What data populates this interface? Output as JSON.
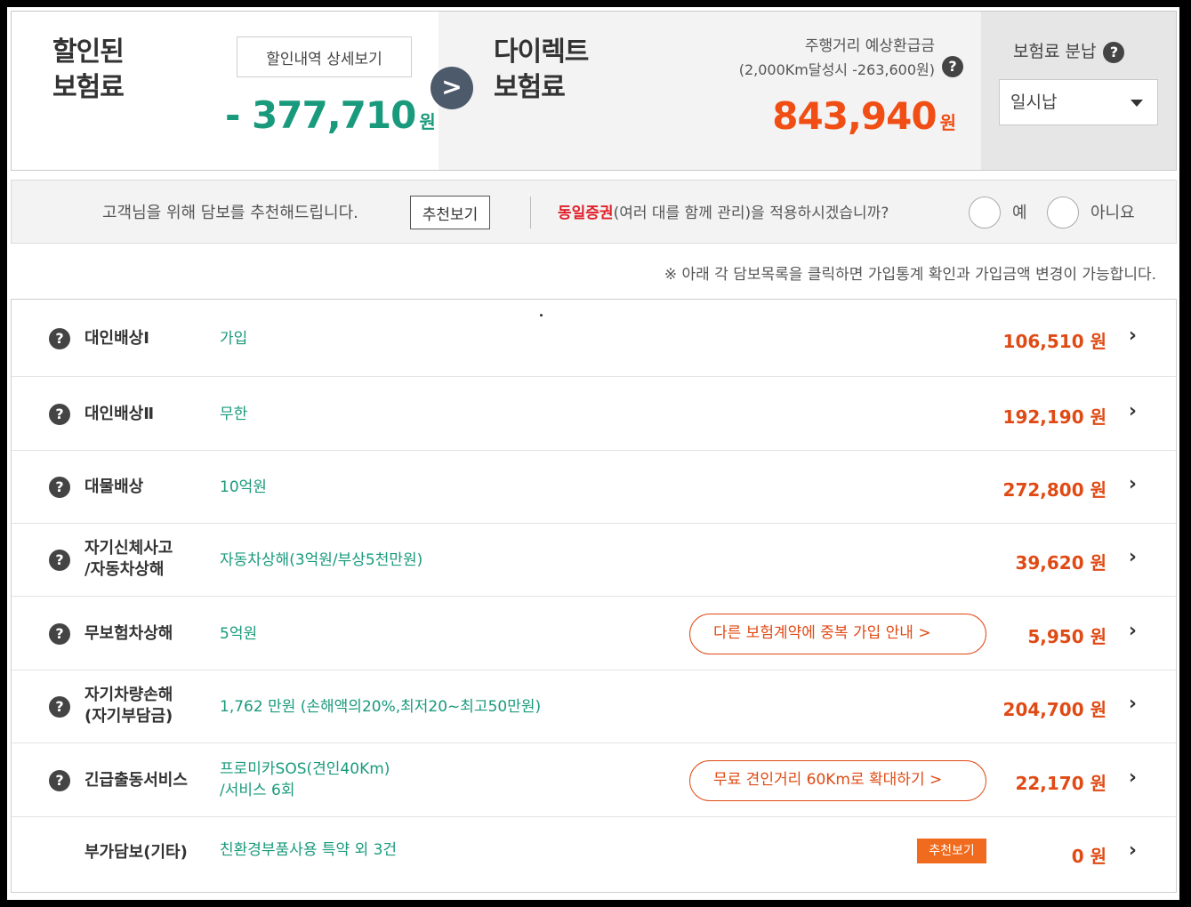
{
  "header": {
    "discounted_label_line1": "할인된",
    "discounted_label_line2": "보험료",
    "detail_button": "할인내역 상세보기",
    "discount_amount": "- 377,710",
    "won": "원",
    "arrow_symbol": ">",
    "direct_label_line1": "다이렉트",
    "direct_label_line2": "보험료",
    "mileage_line1": "주행거리 예상환급금",
    "mileage_line2": "(2,000Km달성시 -263,600원)",
    "direct_amount": "843,940",
    "installment_label": "보험료 분납",
    "installment_value": "일시납",
    "help_symbol": "?"
  },
  "recommend": {
    "text": "고객님을 위해 담보를 추천해드립니다.",
    "button": "추천보기",
    "same_cert_red": "동일증권",
    "same_cert_rest": "(여러 대를 함께 관리)을 적용하시겠습니까?",
    "yes": "예",
    "no": "아니요"
  },
  "notice": "※ 아래 각 담보목록을 클릭하면 가입통계 확인과 가입금액 변경이 가능합니다.",
  "chevron": "›",
  "rows": [
    {
      "name1": "대인배상Ⅰ",
      "name2": "",
      "detail1": "가입",
      "detail2": "",
      "pill": "",
      "tag": "",
      "amount": "106,510 원"
    },
    {
      "name1": "대인배상Ⅱ",
      "name2": "",
      "detail1": "무한",
      "detail2": "",
      "pill": "",
      "tag": "",
      "amount": "192,190 원"
    },
    {
      "name1": "대물배상",
      "name2": "",
      "detail1": "10억원",
      "detail2": "",
      "pill": "",
      "tag": "",
      "amount": "272,800 원"
    },
    {
      "name1": "자기신체사고",
      "name2": "/자동차상해",
      "detail1": "자동차상해(3억원/부상5천만원)",
      "detail2": "",
      "pill": "",
      "tag": "",
      "amount": "39,620 원"
    },
    {
      "name1": "무보험차상해",
      "name2": "",
      "detail1": "5억원",
      "detail2": "",
      "pill": "다른 보험계약에 중복 가입 안내 >",
      "tag": "",
      "amount": "5,950 원"
    },
    {
      "name1": "자기차량손해",
      "name2": "(자기부담금)",
      "detail1": "1,762 만원 (손해액의20%,최저20~최고50만원)",
      "detail2": "",
      "pill": "",
      "tag": "",
      "amount": "204,700 원"
    },
    {
      "name1": "긴급출동서비스",
      "name2": "",
      "detail1": "프로미카SOS(견인40Km)",
      "detail2": "/서비스 6회",
      "pill": "무료 견인거리 60Km로 확대하기 >",
      "tag": "",
      "amount": "22,170 원"
    },
    {
      "name1": "부가담보(기타)",
      "name2": "",
      "detail1": "친환경부품사용 특약 외 3건",
      "detail2": "",
      "pill": "",
      "tag": "추천보기",
      "amount": "0 원"
    }
  ],
  "colors": {
    "green": "#1a9a7c",
    "orange": "#f04e14",
    "red": "#e0202a",
    "tag_orange": "#f06b1e"
  }
}
